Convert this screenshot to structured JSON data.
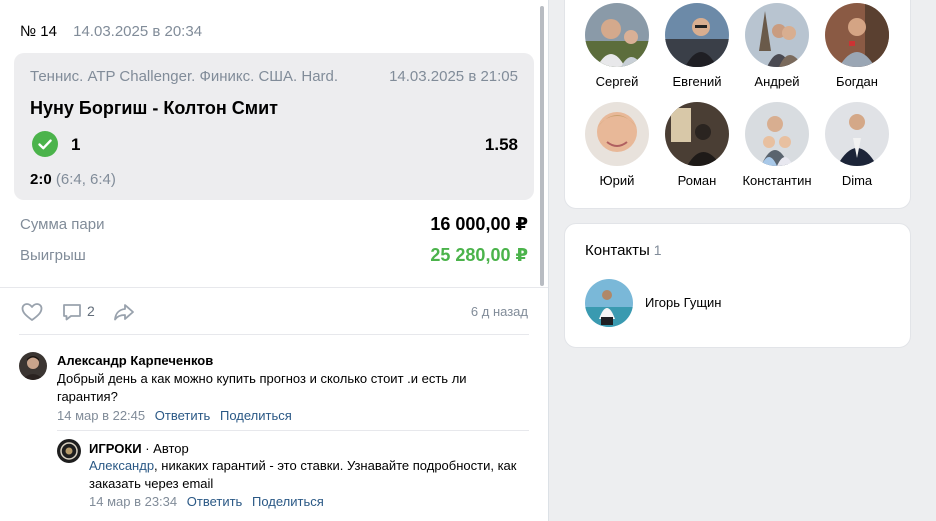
{
  "post": {
    "number": "№ 14",
    "date": "14.03.2025 в 20:34",
    "bet": {
      "league": "Теннис. ATP Challenger. Финикс. США. Hard.",
      "event_time": "14.03.2025 в 21:05",
      "match": "Нуну Боргиш - Колтон Смит",
      "status_icon": "check-circle-icon",
      "status_color": "#4bb34b",
      "outcome": "1",
      "coefficient": "1.58",
      "score": "2:0",
      "sets": "(6:4, 6:4)"
    },
    "stake_label": "Сумма пари",
    "stake_value": "16 000,00 ₽",
    "win_label": "Выигрыш",
    "win_value": "25 280,00 ₽",
    "actions": {
      "like_icon": "heart-icon",
      "comment_icon": "comment-icon",
      "comment_count": "2",
      "share_icon": "share-arrow-icon",
      "time_ago": "6 д назад"
    }
  },
  "comments": [
    {
      "author": "Александр Карпеченков",
      "text": "Добрый день а как можно купить прогноз и сколько стоит .и есть ли гарантия?",
      "time": "14 мар в 22:45",
      "reply_label": "Ответить",
      "share_label": "Поделиться"
    },
    {
      "author": "ИГРОКИ",
      "role": " · Автор",
      "mention": "Александр",
      "text": ", никаких гарантий - это ставки. Узнавайте подробности, как заказать через email",
      "time": "14 мар в 23:34",
      "reply_label": "Ответить",
      "share_label": "Поделиться"
    }
  ],
  "friends": [
    {
      "name": "Сергей"
    },
    {
      "name": "Евгений"
    },
    {
      "name": "Андрей"
    },
    {
      "name": "Богдан"
    },
    {
      "name": "Юрий"
    },
    {
      "name": "Роман"
    },
    {
      "name": "Константин"
    },
    {
      "name": "Dima"
    }
  ],
  "contacts": {
    "title": "Контакты",
    "count": "1",
    "items": [
      {
        "name": "Игорь Гущин"
      }
    ]
  },
  "colors": {
    "accent_link": "#2a5885",
    "win_green": "#4bb34b",
    "muted": "#818c99"
  }
}
